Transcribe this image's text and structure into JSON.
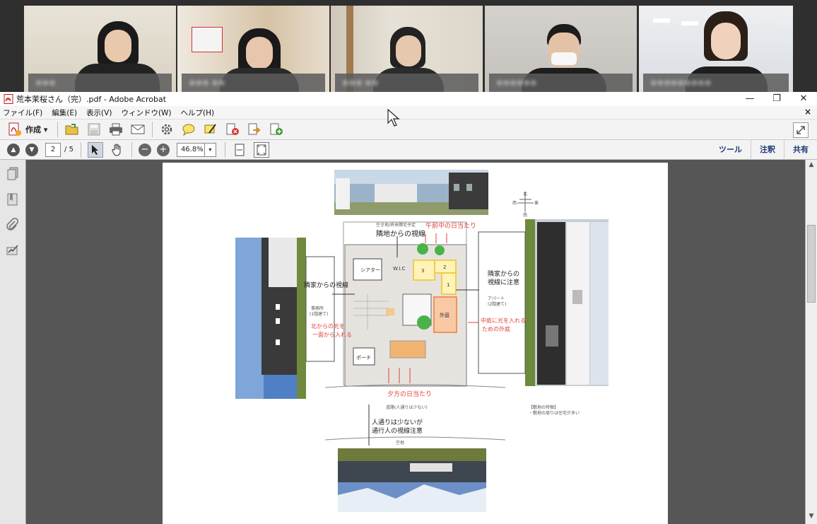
{
  "window": {
    "title": "荒本茉桜さん（完）.pdf - Adobe Acrobat",
    "controls": {
      "minimize": "—",
      "maximize": "❐",
      "close": "✕"
    }
  },
  "menu": [
    "ファイル(F)",
    "編集(E)",
    "表示(V)",
    "ウィンドウ(W)",
    "ヘルプ(H)"
  ],
  "menu_close": "×",
  "toolbar": {
    "create_label": "作成",
    "create_caret": "▾"
  },
  "navigation": {
    "current_page": "2",
    "page_separator": "/",
    "total_pages": "5",
    "zoom": "46.8%",
    "zoom_caret": "▾"
  },
  "right_panel_links": [
    "ツール",
    "注釈",
    "共有"
  ],
  "plan": {
    "top_label_1": "空き地/将来隣宅予定",
    "top_label_2": "隣地からの視線",
    "top_red": "午前中の日当たり",
    "left_note": "隣家からの視線",
    "left_small_1": "事務所",
    "left_small_2": "(1階建て)",
    "left_red_1": "北からの光を",
    "left_red_2": "一面から入れる",
    "right_note_1": "隣家からの",
    "right_note_2": "視線に注意",
    "right_small_1": "アパート",
    "right_small_2": "(2階建て)",
    "right_red_1": "中庭に光を入れる",
    "right_red_2": "ための外庭",
    "room_theater": "シアター",
    "room_wic": "W.I.C",
    "room_outer": "外庭",
    "room_porch": "ポーチ",
    "num_3": "3",
    "num_2": "2",
    "num_1": "1",
    "bottom_red": "夕方の日当たり",
    "road_label": "道路(人通りは少ない)",
    "bottom_note_1": "人通りは少ないが",
    "bottom_note_2": "通行人の視線注意",
    "bottom_small": "空地",
    "legend_title": "【敷地の特徴】",
    "legend_line": "・敷地の周りは住宅が多い",
    "compass_n": "北",
    "compass_s": "南",
    "compass_e": "東",
    "compass_w": "西"
  },
  "participants": [
    {
      "name": "●●●"
    },
    {
      "name": "●●● ●●"
    },
    {
      "name": "●●● ●●"
    },
    {
      "name": "●●●●●●"
    },
    {
      "name": "●●●●●●●●●"
    }
  ],
  "colors": {
    "link": "#1d3c78",
    "annotation_red": "#e0413a",
    "room_yellow": "#f2c744",
    "room_orange": "#f08a4b"
  }
}
